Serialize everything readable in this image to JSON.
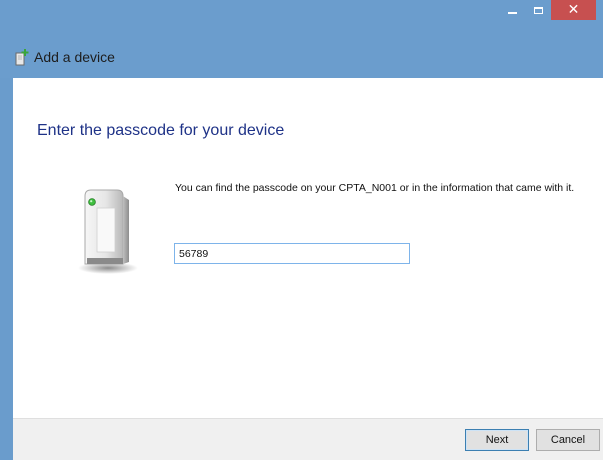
{
  "window": {
    "title": "Add a device",
    "caption_buttons": {
      "minimize_icon": "minimize-icon",
      "maximize_icon": "maximize-icon",
      "close_label": "✕"
    },
    "title_icon": "add-device-icon"
  },
  "main": {
    "heading": "Enter the passcode for your device",
    "device_icon": "printer-device-icon",
    "info_text": "You can find the passcode on your CPTA_N001 or in the information that came with it.",
    "passcode_value": "56789"
  },
  "footer": {
    "next_label": "Next",
    "cancel_label": "Cancel"
  },
  "colors": {
    "titlebar": "#6b9dcd",
    "close_button": "#c75050",
    "heading": "#1e3287",
    "input_border": "#7eb4ea"
  }
}
